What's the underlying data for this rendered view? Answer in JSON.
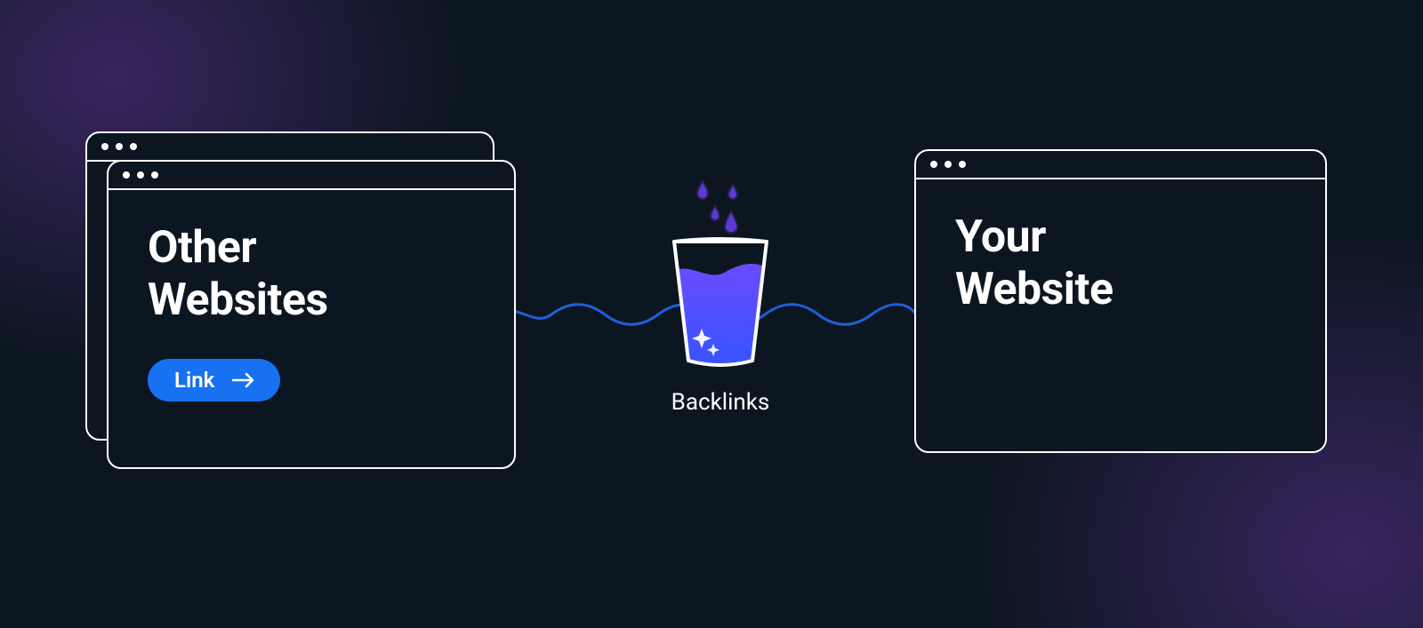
{
  "left": {
    "heading": "Other\nWebsites",
    "link_label": "Link"
  },
  "right": {
    "heading": "Your\nWebsite"
  },
  "center": {
    "label": "Backlinks"
  },
  "colors": {
    "accent_blue": "#1771f1",
    "wave_blue": "#1e5fd6",
    "cup_fill_top": "#6a4bff",
    "cup_fill_bottom": "#3554ff",
    "drop_purple": "#5b3bd8",
    "drop_outline": "#2a2350"
  }
}
